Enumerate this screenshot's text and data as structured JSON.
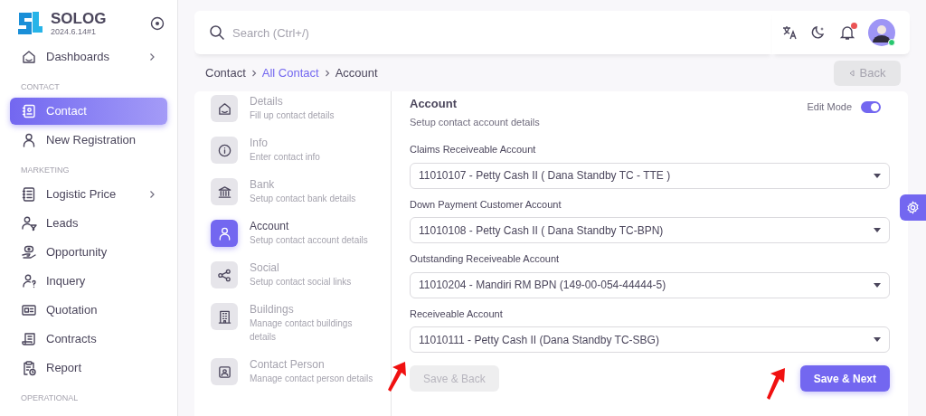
{
  "brand": {
    "name": "SOLOG",
    "version": "2024.6.14#1"
  },
  "sidebar": [
    {
      "kind": "item",
      "label": "Dashboards",
      "selected": false,
      "has_submenu": true
    },
    {
      "kind": "heading",
      "label": "CONTACT"
    },
    {
      "kind": "item",
      "label": "Contact",
      "selected": true,
      "has_submenu": false
    },
    {
      "kind": "item",
      "label": "New Registration",
      "selected": false,
      "has_submenu": false
    },
    {
      "kind": "heading",
      "label": "MARKETING"
    },
    {
      "kind": "item",
      "label": "Logistic Price",
      "selected": false,
      "has_submenu": true
    },
    {
      "kind": "item",
      "label": "Leads",
      "selected": false,
      "has_submenu": false
    },
    {
      "kind": "item",
      "label": "Opportunity",
      "selected": false,
      "has_submenu": false
    },
    {
      "kind": "item",
      "label": "Inquery",
      "selected": false,
      "has_submenu": false
    },
    {
      "kind": "item",
      "label": "Quotation",
      "selected": false,
      "has_submenu": false
    },
    {
      "kind": "item",
      "label": "Contracts",
      "selected": false,
      "has_submenu": false
    },
    {
      "kind": "item",
      "label": "Report",
      "selected": false,
      "has_submenu": false
    },
    {
      "kind": "heading",
      "label": "OPERATIONAL"
    }
  ],
  "topbar": {
    "search": {
      "placeholder": "Search (Ctrl+/)"
    },
    "notifications_unread": true,
    "user_online": true
  },
  "breadcrumb": [
    {
      "label": "Contact",
      "link": false
    },
    {
      "label": "All Contact",
      "link": true
    },
    {
      "label": "Account",
      "link": false
    }
  ],
  "back_button": {
    "label": "Back",
    "disabled": true
  },
  "steps": [
    {
      "title": "Details",
      "description": "Fill up contact details",
      "selected": false
    },
    {
      "title": "Info",
      "description": "Enter contact info",
      "selected": false
    },
    {
      "title": "Bank",
      "description": "Setup contact bank details",
      "selected": false
    },
    {
      "title": "Account",
      "description": "Setup contact account details",
      "selected": true
    },
    {
      "title": "Social",
      "description": "Setup contact social links",
      "selected": false
    },
    {
      "title": "Buildings",
      "description": "Manage contact buildings details",
      "selected": false
    },
    {
      "title": "Contact Person",
      "description": "Manage contact person details",
      "selected": false
    }
  ],
  "form": {
    "title": "Account",
    "description": "Setup contact account details",
    "edit_mode": {
      "label": "Edit Mode",
      "on": true
    },
    "fields": [
      {
        "label": "Claims Receiveable Account",
        "value": "11010107 - Petty Cash II ( Dana Standby TC - TTE )"
      },
      {
        "label": "Down Payment Customer Account",
        "value": "11010108 - Petty Cash II ( Dana Standby TC-BPN)"
      },
      {
        "label": "Outstanding Receiveable Account",
        "value": "11010204 - Mandiri RM BPN (149-00-054-44444-5)"
      },
      {
        "label": "Receiveable Account",
        "value": "11010111 - Petty Cash II (Dana Standby TC-SBG)"
      }
    ],
    "buttons": [
      {
        "label": "Save & Back",
        "disabled": true
      },
      {
        "label": "Save & Next",
        "disabled": false
      }
    ]
  }
}
